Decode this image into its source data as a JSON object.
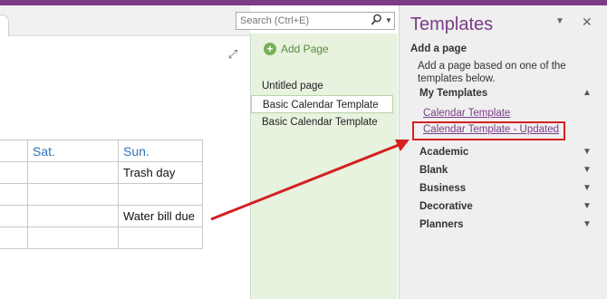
{
  "search": {
    "placeholder": "Search (Ctrl+E)"
  },
  "calendar": {
    "headers": [
      "",
      "Sat.",
      "Sun."
    ],
    "rows": [
      [
        "",
        "",
        "Trash day"
      ],
      [
        "",
        "",
        ""
      ],
      [
        "",
        "",
        "Water bill due"
      ],
      [
        "",
        "",
        ""
      ]
    ]
  },
  "pages": {
    "add_label": "Add Page",
    "items": [
      "Untitled page",
      "Basic Calendar Template",
      "Basic Calendar Template"
    ],
    "selected_index": 1
  },
  "templates": {
    "title": "Templates",
    "add_a_page": "Add a page",
    "description": "Add a page based on one of the templates below.",
    "my_templates": "My Templates",
    "links": [
      "Calendar Template",
      "Calendar Template - Updated"
    ],
    "sections": [
      "Academic",
      "Blank",
      "Business",
      "Decorative",
      "Planners"
    ]
  },
  "colors": {
    "accent": "#7a3c86",
    "annotation": "#d42020",
    "page_pane": "#e7f2df",
    "table_header": "#2e75b6"
  }
}
